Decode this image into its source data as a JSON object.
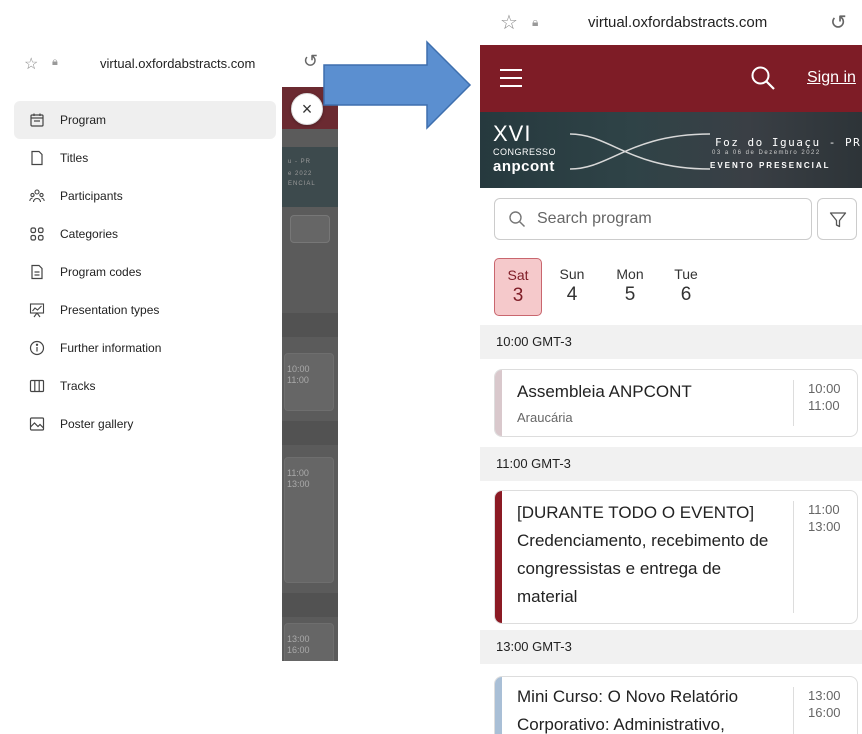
{
  "left_screen": {
    "url": "virtual.oxfordabstracts.com",
    "close_label": "×",
    "menu_items": [
      {
        "label": "Program",
        "icon": "calendar-icon"
      },
      {
        "label": "Titles",
        "icon": "document-icon"
      },
      {
        "label": "Participants",
        "icon": "people-icon"
      },
      {
        "label": "Categories",
        "icon": "grid-icon"
      },
      {
        "label": "Program codes",
        "icon": "code-doc-icon"
      },
      {
        "label": "Presentation types",
        "icon": "presentation-icon"
      },
      {
        "label": "Further information",
        "icon": "info-icon"
      },
      {
        "label": "Tracks",
        "icon": "tracks-icon"
      },
      {
        "label": "Poster gallery",
        "icon": "image-icon"
      }
    ],
    "background_fragments": {
      "banner_text": [
        "u - PR",
        "e 2022",
        "ENCIAL"
      ],
      "times": [
        [
          "10:00",
          "11:00"
        ],
        [
          "11:00",
          "13:00"
        ],
        [
          "13:00",
          "16:00"
        ]
      ]
    }
  },
  "right_screen": {
    "url": "virtual.oxfordabstracts.com",
    "header": {
      "sign_in": "Sign in",
      "color": "#7e1c26"
    },
    "banner": {
      "edition": "XVI",
      "congresso": "CONGRESSO",
      "brand": "anpcont",
      "location": "Foz do Iguaçu - PR",
      "dates": "03 a 06 de Dezembro 2022",
      "mode": "EVENTO PRESENCIAL"
    },
    "search": {
      "placeholder": "Search program"
    },
    "days": [
      {
        "name": "Sat",
        "date": "3",
        "selected": true
      },
      {
        "name": "Sun",
        "date": "4",
        "selected": false
      },
      {
        "name": "Mon",
        "date": "5",
        "selected": false
      },
      {
        "name": "Tue",
        "date": "6",
        "selected": false
      }
    ],
    "time_groups": [
      {
        "label": "10:00 GMT-3",
        "session": {
          "title": "Assembleia ANPCONT",
          "room": "Araucária",
          "start": "10:00",
          "end": "11:00",
          "color": "#d9c8cc"
        }
      },
      {
        "label": "11:00 GMT-3",
        "session": {
          "title": "[DURANTE TODO O EVENTO] Credenciamento, recebimento de congressistas e entrega de material",
          "room": "",
          "start": "11:00",
          "end": "13:00",
          "color": "#8b1a24"
        }
      },
      {
        "label": "13:00 GMT-3",
        "session": {
          "title": "Mini Curso: O Novo Relatório Corporativo: Administrativo,",
          "room": "",
          "start": "13:00",
          "end": "16:00",
          "color": "#a9bfd6"
        }
      }
    ]
  },
  "arrow": {
    "color": "#5b8fd0",
    "border": "#3e6fae"
  }
}
